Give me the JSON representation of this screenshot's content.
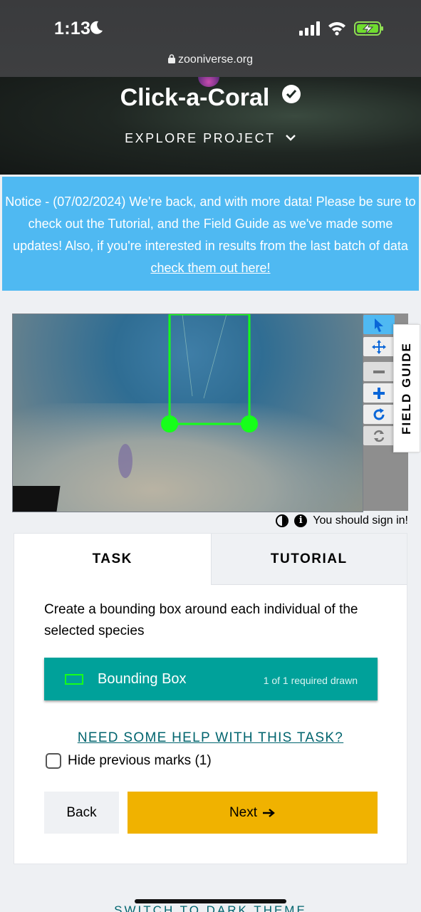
{
  "status_bar": {
    "time": "1:13",
    "url": "zooniverse.org"
  },
  "hero": {
    "title": "Click-a-Coral",
    "explore_label": "EXPLORE PROJECT"
  },
  "notice": {
    "text": "Notice - (07/02/2024) We're back, and with more data! Please be sure to check out the Tutorial, and the Field Guide as we've made some updates! Also, if you're interested in results from the last batch of data ",
    "link_text": "check them out here!"
  },
  "viewer": {
    "tools": [
      "pointer-icon",
      "pan-icon",
      "zoom-out-icon",
      "zoom-in-icon",
      "rotate-icon",
      "reset-icon"
    ],
    "field_guide_label": "FIELD GUIDE",
    "mark_color": "#16ff1a"
  },
  "meta": {
    "sign_in_text": "You should sign in!"
  },
  "task_panel": {
    "tabs": [
      {
        "label": "TASK"
      },
      {
        "label": "TUTORIAL"
      }
    ],
    "instructions": "Create a bounding box around each individual of the selected species",
    "tool_button": {
      "label": "Bounding Box",
      "count_text": "1 of 1 required drawn",
      "swatch_color": "#16ff1a"
    },
    "help_link": "NEED SOME HELP WITH THIS TASK?",
    "hide_marks_label": "Hide previous marks (1)",
    "back_label": "Back",
    "next_label": "Next"
  },
  "footer": {
    "dark_theme_label": "SWITCH TO DARK THEME"
  },
  "colors": {
    "notice_bg": "#4fb9f2",
    "teal": "#00a19a",
    "next_bg": "#f0b200",
    "link": "#00646e"
  }
}
